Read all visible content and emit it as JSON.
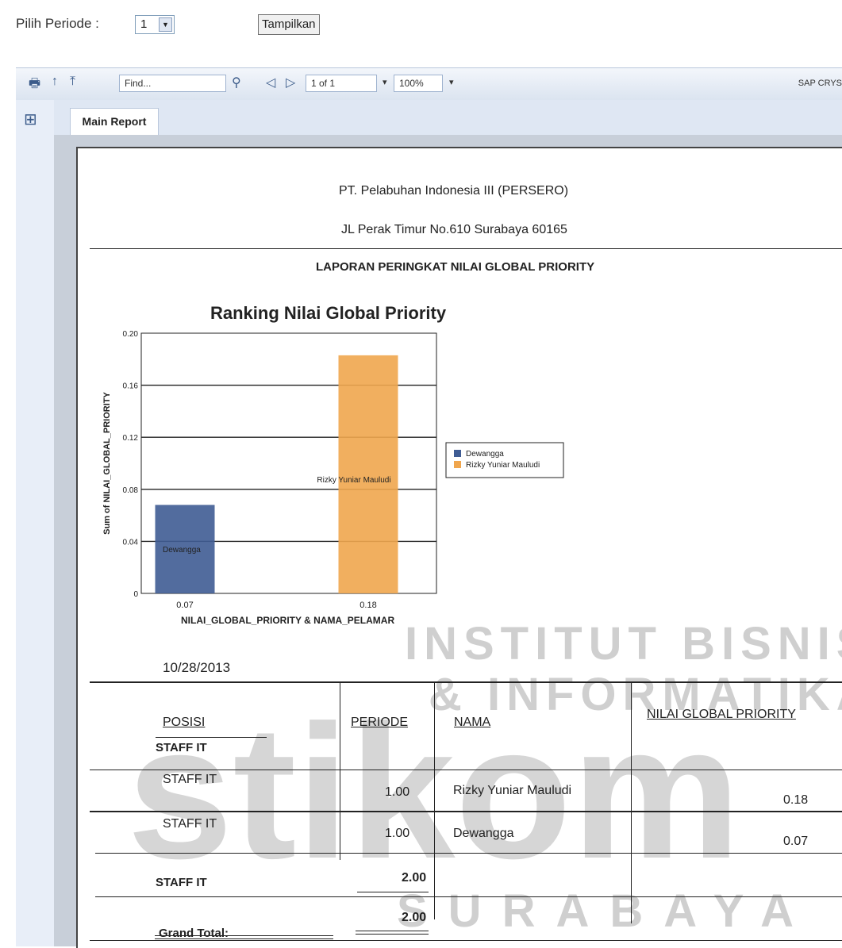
{
  "filter": {
    "label": "Pilih Periode :",
    "period_value": "1",
    "show_button": "Tampilkan"
  },
  "toolbar": {
    "find_placeholder": "Find...",
    "page_indicator": "1 of 1",
    "zoom": "100%",
    "brand_text": "SAP CRYS"
  },
  "tabs": {
    "main_report": "Main Report"
  },
  "report": {
    "company": "PT. Pelabuhan Indonesia III (PERSERO)",
    "address": "JL Perak Timur No.610 Surabaya 60165",
    "title": "LAPORAN PERINGKAT NILAI GLOBAL PRIORITY",
    "date": "10/28/2013",
    "table": {
      "headers": {
        "posisi": "POSISI",
        "periode": "PERIODE",
        "nama": "NAMA",
        "nilai": "NILAI GLOBAL PRIORITY"
      },
      "group_label": "STAFF IT",
      "rows": [
        {
          "posisi": "STAFF IT",
          "periode": "1.00",
          "nama": "Rizky Yuniar Mauludi",
          "nilai": "0.18"
        },
        {
          "posisi": "STAFF IT",
          "periode": "1.00",
          "nama": "Dewangga",
          "nilai": "0.07"
        }
      ],
      "subtotal_label": "STAFF IT",
      "subtotal_value": "2.00",
      "grand_total_label": "Grand Total:",
      "grand_total_value": "2.00"
    }
  },
  "chart_data": {
    "type": "bar",
    "title": "Ranking Nilai Global Priority",
    "xlabel": "NILAI_GLOBAL_PRIORITY & NAMA_PELAMAR",
    "ylabel": "Sum of NILAI_GLOBAL_PRIORITY",
    "categories": [
      "0.07",
      "0.18"
    ],
    "series": [
      {
        "name": "Dewangga",
        "values": [
          0.068,
          null
        ],
        "color": "#3f5c94",
        "bar_label": "Dewangga"
      },
      {
        "name": "Rizky Yuniar Mauludi",
        "values": [
          null,
          0.183
        ],
        "color": "#f0a64e",
        "bar_label": "Rizky Yuniar Mauludi"
      }
    ],
    "ylim": [
      0,
      0.2
    ],
    "yticks": [
      "0",
      "0.04",
      "0.08",
      "0.12",
      "0.16",
      "0.20"
    ],
    "grid": true,
    "legend_position": "right"
  },
  "watermark": {
    "line1": "INSTITUT BISNIS",
    "line2": "& INFORMATIKA",
    "line3": "stikom",
    "line4": "SURABAYA"
  },
  "colors": {
    "toolbar_bg": "#dbe4f0",
    "panel_bg": "#e8eef8",
    "bar_dewangga": "#3f5c94",
    "bar_rizky": "#f0a64e"
  }
}
